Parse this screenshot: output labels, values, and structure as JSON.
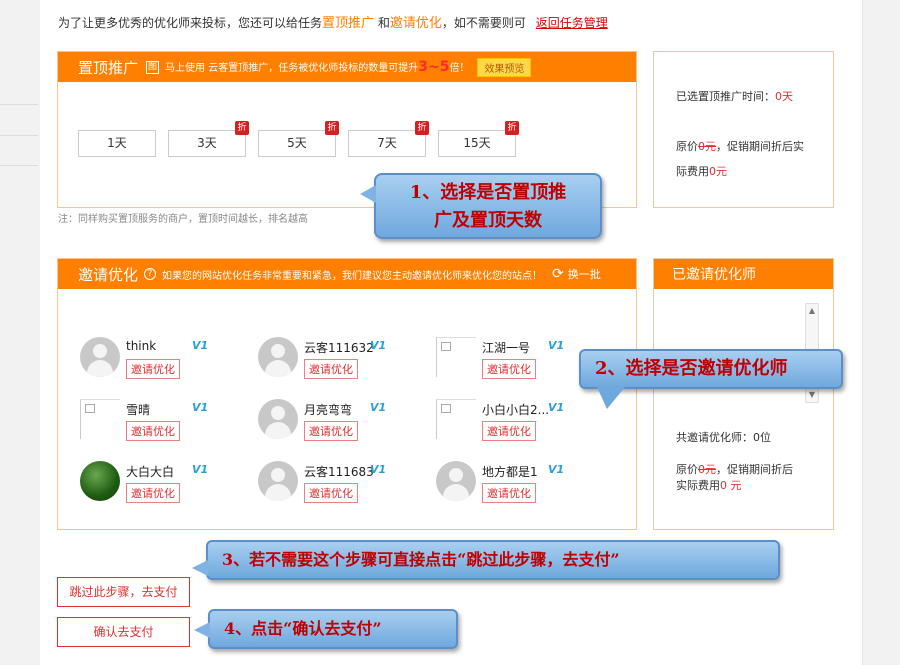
{
  "intro": {
    "text1": "为了让更多优秀的优化师来投标，您还可以给任务",
    "hl1": "置顶推广",
    "text2": "和",
    "hl2": "邀请优化",
    "text3": "，如不需要则可",
    "link": "返回任务管理"
  },
  "top": {
    "title": "置顶推广",
    "badge": "图",
    "desc_pre": "马上使用 云客置顶推广，任务被优化师投标的数量可提升",
    "desc_num": "3~5",
    "desc_post": "倍！",
    "preview_btn": "效果预览",
    "days": [
      {
        "label": "1天",
        "discount": ""
      },
      {
        "label": "3天",
        "discount": "折"
      },
      {
        "label": "5天",
        "discount": "折"
      },
      {
        "label": "7天",
        "discount": "折"
      },
      {
        "label": "15天",
        "discount": "折"
      }
    ],
    "note": "注：同样购买置顶服务的商户，置顶时间越长，排名越高"
  },
  "top_side": {
    "selected_label": "已选置顶推广时间：",
    "selected_value": "0天",
    "price_pre": "原价",
    "price_strike": "0元",
    "price_mid": "，促销期间折后实",
    "price_line2_pre": "际费用",
    "price_line2_val": "0元"
  },
  "invite": {
    "title": "邀请优化",
    "help_icon": "?",
    "desc": "如果您的网站优化任务非常重要和紧急，我们建议您主动邀请优化师来优化您的站点！",
    "refresh_label": "换一批",
    "invite_label": "邀请优化",
    "v_badge": "V1",
    "users": [
      {
        "name": "think",
        "avatar": "person"
      },
      {
        "name": "云客111632",
        "avatar": "person"
      },
      {
        "name": "江湖一号",
        "avatar": "broken"
      },
      {
        "name": "雪晴",
        "avatar": "broken"
      },
      {
        "name": "月亮弯弯",
        "avatar": "person"
      },
      {
        "name": "小白小白2...",
        "avatar": "broken"
      },
      {
        "name": "大白大白",
        "avatar": "green"
      },
      {
        "name": "云客111683",
        "avatar": "person"
      },
      {
        "name": "地方都是1",
        "avatar": "person"
      }
    ]
  },
  "invite_side": {
    "title": "已邀请优化师",
    "count_label": "共邀请优化师：0位",
    "price_pre": "原价",
    "price_strike": "0元",
    "price_mid": "，促销期间折后",
    "price_line2_pre": "实际费用",
    "price_line2_val": "0 元"
  },
  "actions": {
    "skip": "跳过此步骤，去支付",
    "confirm": "确认去支付"
  },
  "callouts": {
    "c1": "1、选择是否置顶推广及置顶天数",
    "c1_line1": "1、选择是否置顶推",
    "c1_line2": "广及置顶天数",
    "c2": "2、选择是否邀请优化师",
    "c3": "3、若不需要这个步骤可直接点击“跳过此步骤，去支付”",
    "c4": "4、点击“确认去支付”"
  }
}
